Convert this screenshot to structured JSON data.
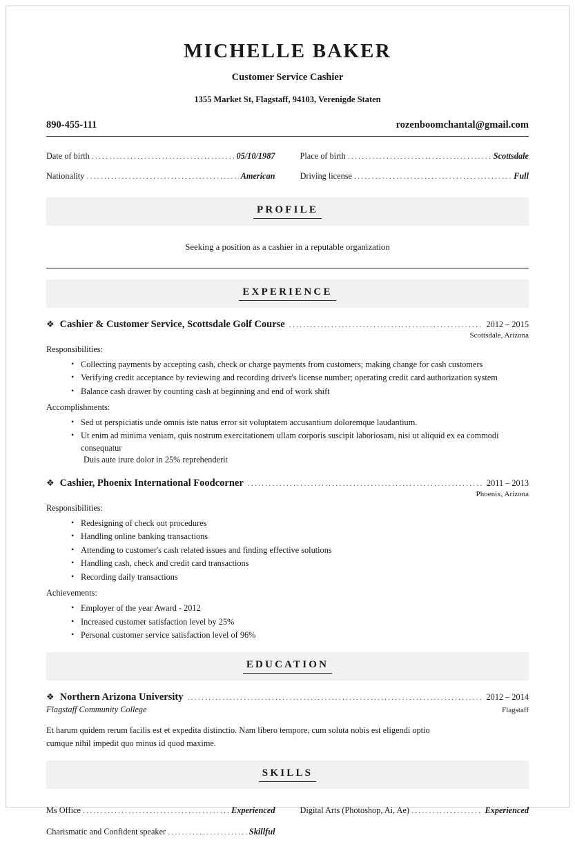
{
  "header": {
    "name": "MICHELLE BAKER",
    "job_title": "Customer Service Cashier",
    "address": "1355 Market St, Flagstaff, 94103, Verenigde Staten",
    "phone": "890-455-111",
    "email": "rozenboomchantal@gmail.com"
  },
  "details": {
    "left": [
      {
        "label": "Date of birth",
        "value": "05/10/1987"
      },
      {
        "label": "Nationality",
        "value": "American"
      }
    ],
    "right": [
      {
        "label": "Place of birth",
        "value": "Scottsdale"
      },
      {
        "label": "Driving license",
        "value": "Full"
      }
    ]
  },
  "sections": {
    "profile_title": "PROFILE",
    "experience_title": "EXPERIENCE",
    "education_title": "EDUCATION",
    "skills_title": "SKILLS"
  },
  "profile": {
    "text": "Seeking a position as a cashier in a reputable organization"
  },
  "experience": [
    {
      "marker": "diamond-bullet-icon",
      "title": "Cashier & Customer Service, Scottsdale Golf Course",
      "date": "2012 – 2015",
      "location": "Scottsdale, Arizona",
      "group1_label": "Responsibilities:",
      "group1_items": [
        "Collecting payments by accepting cash, check or charge payments from customers; making change for cash customers",
        "Verifying credit acceptance by reviewing and recording driver's license number; operating credit card authorization system",
        "Balance cash drawer by counting cash at beginning and end of work shift"
      ],
      "group2_label": "Accomplishments:",
      "group2_items": [
        "Sed ut perspiciatis unde omnis iste natus error sit voluptatem accusantium doloremque laudantium.",
        "Ut enim ad minima veniam, quis nostrum exercitationem ullam corporis suscipit laboriosam, nisi ut aliquid ex ea commodi consequatur"
      ],
      "group2_continuation": "Duis aute irure dolor in 25% reprehenderit"
    },
    {
      "marker": "diamond-bullet-icon",
      "title": "Cashier, Phoenix International Foodcorner",
      "date": "2011 – 2013",
      "location": "Phoenix, Arizona",
      "group1_label": "Responsibilities:",
      "group1_items": [
        "Redesigning of check out procedures",
        "Handling online banking transactions",
        "Attending to customer's cash related issues and finding effective solutions",
        "Handling cash, check and credit card transactions",
        "Recording daily transactions"
      ],
      "group2_label": "Achievements:",
      "group2_items": [
        "Employer of the year Award - 2012",
        "Increased customer satisfaction level by 25%",
        "Personal customer service satisfaction level of 96%"
      ],
      "group2_continuation": ""
    }
  ],
  "education": [
    {
      "marker": "diamond-bullet-icon",
      "title": "Northern Arizona University",
      "date": "2012 – 2014",
      "location": "Flagstaff",
      "subtitle": "Flagstaff Community College",
      "description": "Et harum quidem rerum facilis est et expedita distinctio. Nam libero tempore, cum soluta nobis est eligendi optio cumque nihil impedit quo minus id quod maxime."
    }
  ],
  "skills": {
    "left": [
      {
        "label": "Ms Office",
        "value": "Experienced"
      },
      {
        "label": "Charismatic and Confident speaker",
        "value": "Skillful"
      }
    ],
    "right": [
      {
        "label": "Digital Arts (Photoshop, Ai, Ae)",
        "value": "Experienced"
      }
    ]
  }
}
